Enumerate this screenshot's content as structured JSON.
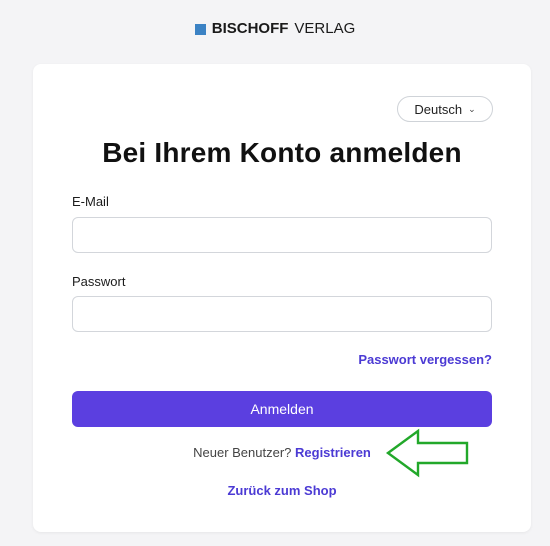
{
  "brand": {
    "name_bold": "BISCHOFF",
    "name_regular": "VERLAG",
    "square_color": "#3b82c4"
  },
  "language": {
    "selected": "Deutsch"
  },
  "login": {
    "title": "Bei Ihrem Konto anmelden",
    "email_label": "E-Mail",
    "email_value": "",
    "password_label": "Passwort",
    "password_value": "",
    "forgot_link": "Passwort vergessen?",
    "submit_label": "Anmelden",
    "new_user_text": "Neuer Benutzer?",
    "register_link": "Registrieren",
    "back_link": "Zurück zum Shop"
  },
  "colors": {
    "accent": "#5b3fe0",
    "link": "#4b3ad4",
    "annotation_arrow": "#22a82a"
  },
  "icons": {
    "language_dropdown": "chevron-down-icon",
    "annotation": "arrow-left-icon"
  }
}
